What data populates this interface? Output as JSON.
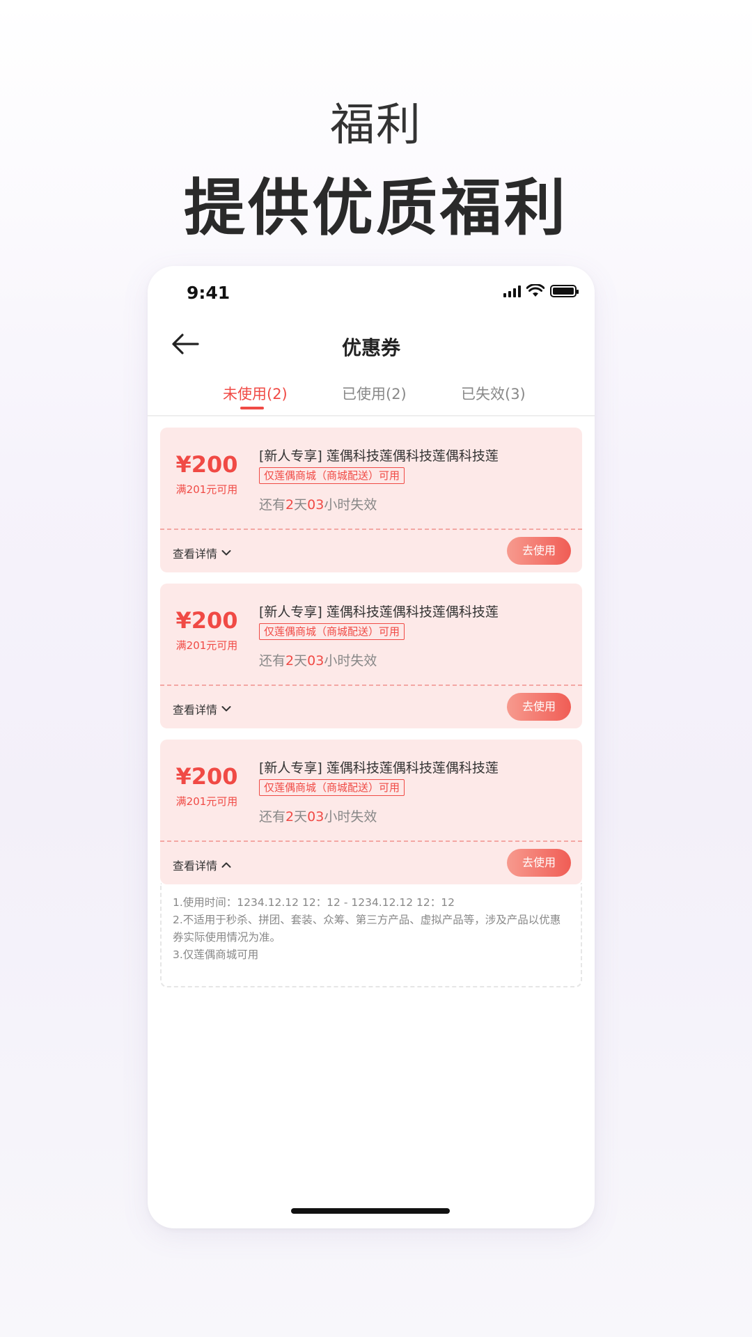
{
  "hero": {
    "subtitle": "福利",
    "title": "提供优质福利"
  },
  "status_bar": {
    "time": "9:41",
    "icons": [
      "signal-icon",
      "wifi-icon",
      "battery-icon"
    ]
  },
  "nav": {
    "title": "优惠券",
    "back_icon": "back-arrow-icon"
  },
  "tabs": [
    {
      "label": "未使用(2)",
      "active": true
    },
    {
      "label": "已使用(2)",
      "active": false
    },
    {
      "label": "已失效(3)",
      "active": false
    }
  ],
  "coupons": [
    {
      "amount": "¥200",
      "condition": "满201元可用",
      "title": "[新人专享] 莲偶科技莲偶科技莲偶科技莲",
      "scope": "仅莲偶商城（商城配送）可用",
      "expire_prefix": "还有",
      "days": "2",
      "days_unit": "天",
      "hours": "03",
      "expire_suffix": "小时失效",
      "detail_label": "查看详情",
      "detail_icon": "chevron-down-icon",
      "use_label": "去使用"
    },
    {
      "amount": "¥200",
      "condition": "满201元可用",
      "title": "[新人专享] 莲偶科技莲偶科技莲偶科技莲",
      "scope": "仅莲偶商城（商城配送）可用",
      "expire_prefix": "还有",
      "days": "2",
      "days_unit": "天",
      "hours": "03",
      "expire_suffix": "小时失效",
      "detail_label": "查看详情",
      "detail_icon": "chevron-down-icon",
      "use_label": "去使用"
    },
    {
      "amount": "¥200",
      "condition": "满201元可用",
      "title": "[新人专享] 莲偶科技莲偶科技莲偶科技莲",
      "scope": "仅莲偶商城（商城配送）可用",
      "expire_prefix": "还有",
      "days": "2",
      "days_unit": "天",
      "hours": "03",
      "expire_suffix": "小时失效",
      "detail_label": "查看详情",
      "detail_icon": "chevron-up-icon",
      "use_label": "去使用"
    }
  ],
  "rules": [
    "1.使用时间：1234.12.12  12：12 - 1234.12.12  12：12",
    "2.不适用于秒杀、拼团、套装、众筹、第三方产品、虚拟产品等，涉及产品以优惠券实际使用情况为准。",
    "3.仅莲偶商城可用"
  ],
  "colors": {
    "accent": "#f04a45",
    "coupon_bg": "#fde9e8",
    "button_start": "#f79a8e",
    "button_end": "#f05d55"
  }
}
